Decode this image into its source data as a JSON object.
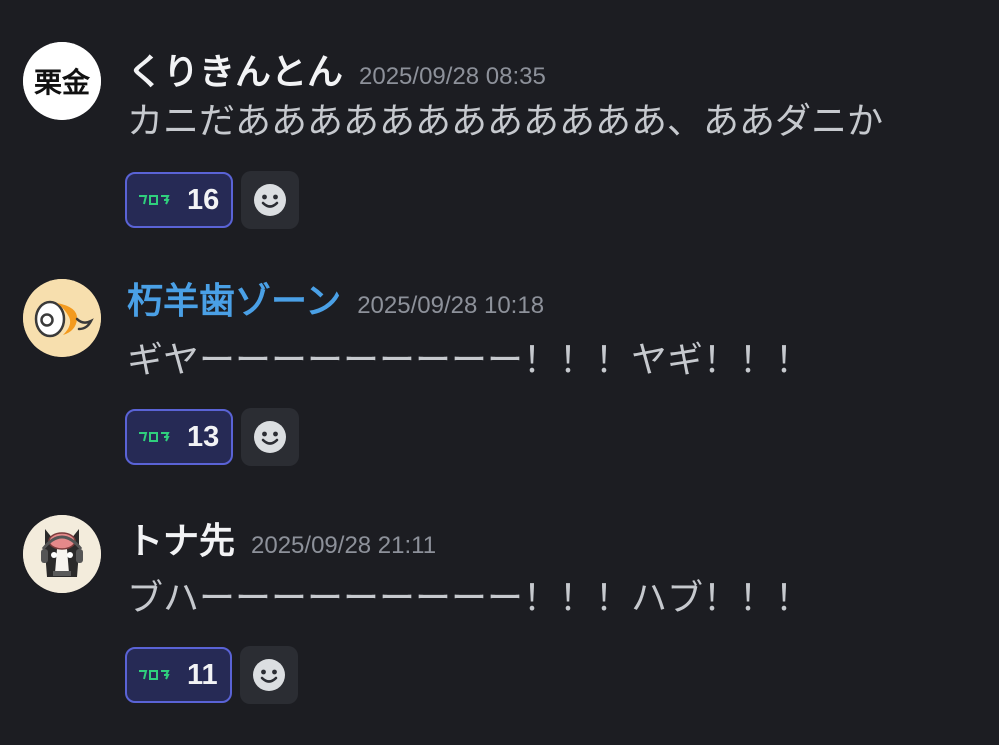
{
  "messages": [
    {
      "username": "くりきんとん",
      "timestamp": "2025/09/28 08:35",
      "content": "カニだああああああああああああ、ああダニか",
      "avatar_text": "栗金",
      "reaction": {
        "emoji": "custom-emoji-green-text",
        "count": "16"
      }
    },
    {
      "username": "朽羊歯ゾーン",
      "timestamp": "2025/09/28 10:18",
      "content": "ギヤーーーーーーーーー！！！ヤギ！！！",
      "reaction": {
        "emoji": "custom-emoji-green-text",
        "count": "13"
      }
    },
    {
      "username": "トナ先",
      "timestamp": "2025/09/28 21:11",
      "content": "ブハーーーーーーーーー！！！ハブ！！！",
      "reaction": {
        "emoji": "custom-emoji-green-text",
        "count": "11"
      }
    }
  ],
  "colors": {
    "background": "#1c1d22",
    "username_default": "#f2f3f5",
    "username_accent": "#4aa0e6",
    "timestamp": "#8d919a",
    "reaction_bg": "#262a55",
    "reaction_border": "#5a63d6",
    "emoji_green": "#2fcf7d"
  }
}
